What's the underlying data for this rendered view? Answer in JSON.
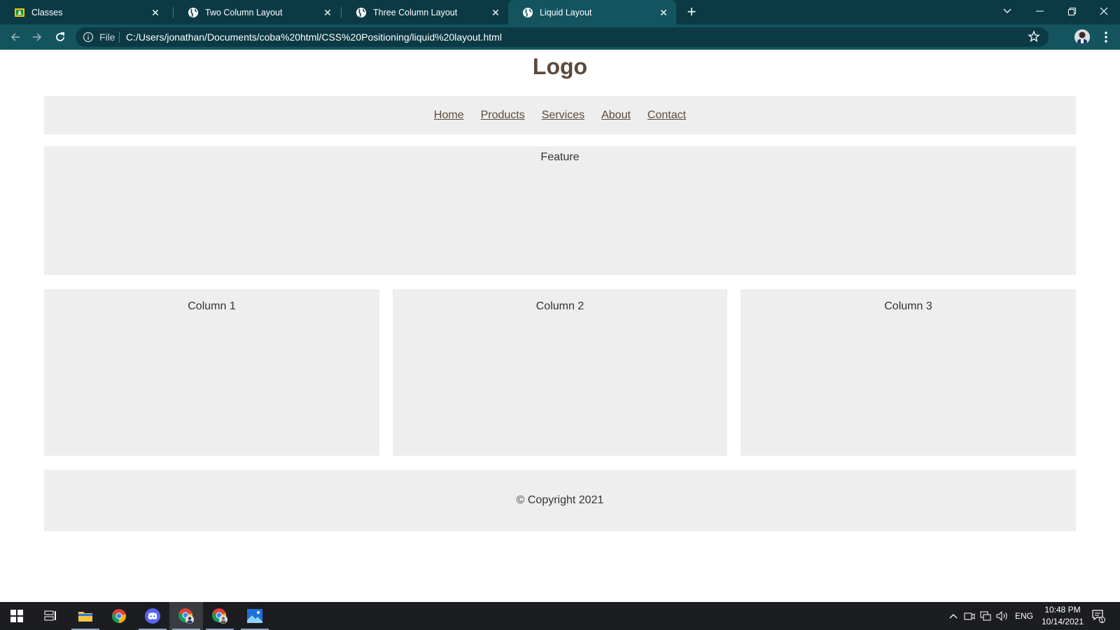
{
  "browser": {
    "tabs": [
      {
        "title": "Classes",
        "icon": "classroom-icon",
        "active": false
      },
      {
        "title": "Two Column Layout",
        "icon": "globe-icon",
        "active": false
      },
      {
        "title": "Three Column Layout",
        "icon": "globe-icon",
        "active": false
      },
      {
        "title": "Liquid Layout",
        "icon": "globe-icon",
        "active": true
      }
    ],
    "omnibox": {
      "scheme_label": "File",
      "url": "C:/Users/jonathan/Documents/coba%20html/CSS%20Positioning/liquid%20layout.html"
    },
    "colors": {
      "tabbar": "#0b3a45",
      "toolbar": "#14545f"
    }
  },
  "page": {
    "logo": "Logo",
    "nav": [
      "Home",
      "Products",
      "Services",
      "About",
      "Contact"
    ],
    "feature": "Feature",
    "columns": [
      "Column 1",
      "Column 2",
      "Column 3"
    ],
    "footer": "© Copyright 2021",
    "colors": {
      "panel": "#eeeeee",
      "link": "#5a4a3c"
    }
  },
  "taskbar": {
    "language": "ENG",
    "time": "10:48 PM",
    "date": "10/14/2021",
    "notification_count": "1"
  }
}
